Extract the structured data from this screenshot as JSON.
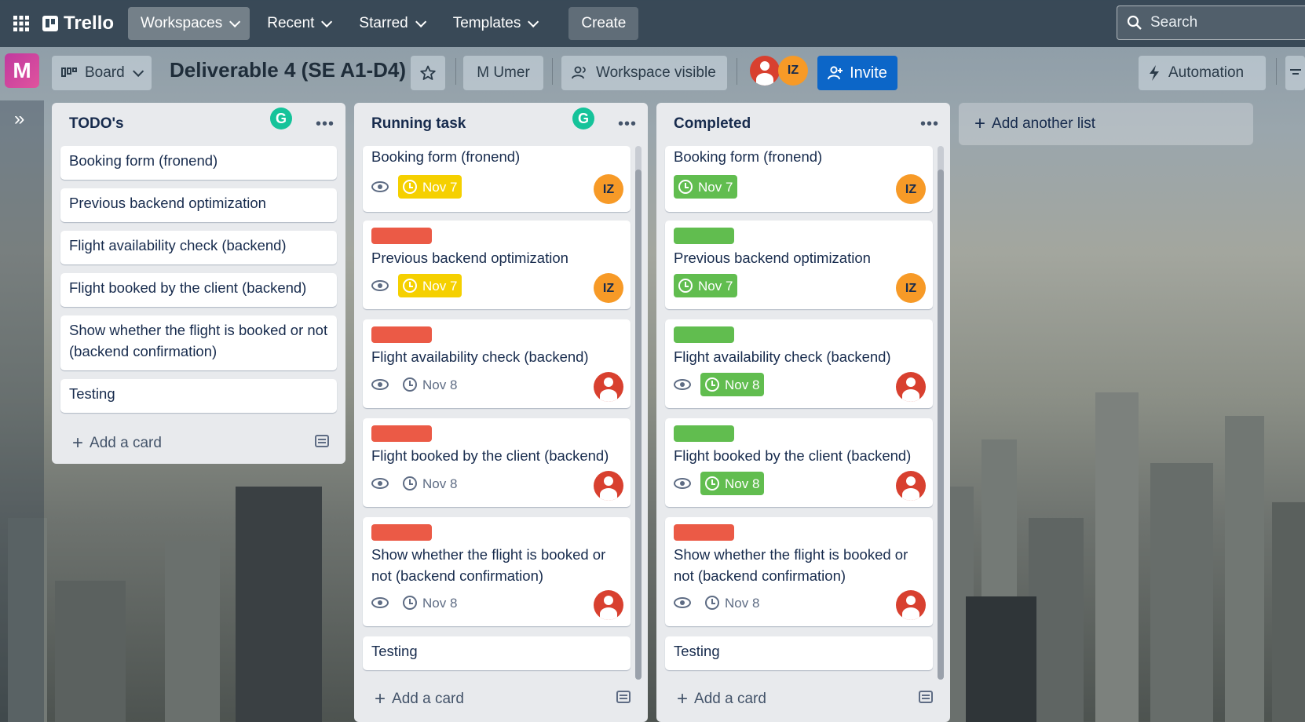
{
  "nav": {
    "logo": "Trello",
    "workspaces": "Workspaces",
    "recent": "Recent",
    "starred": "Starred",
    "templates": "Templates",
    "create": "Create",
    "search_placeholder": "Search"
  },
  "board": {
    "workspace_initial": "M",
    "view": "Board",
    "title": "Deliverable 4 (SE A1-D4)",
    "workspace_name": "M Umer",
    "visibility": "Workspace visible",
    "member_initials": "IZ",
    "invite": "Invite",
    "automation": "Automation"
  },
  "lists": [
    {
      "title": "TODO's",
      "cards": [
        "Booking form (fronend)",
        "Previous backend optimization",
        "Flight availability check (backend)",
        "Flight booked by the client (backend)",
        "Show whether the flight is booked or not (backend confirmation)",
        "Testing"
      ],
      "add_card": "Add a card"
    },
    {
      "title": "Running task",
      "cards": [
        {
          "text": "Booking form (fronend)",
          "due": "Nov 7",
          "due_style": "yellow",
          "member": "IZ"
        },
        {
          "text": "Previous backend optimization",
          "label": "red",
          "due": "Nov 7",
          "due_style": "yellow",
          "member": "IZ"
        },
        {
          "text": "Flight availability check (backend)",
          "label": "red",
          "due": "Nov 8",
          "due_style": "none",
          "member": "avatar"
        },
        {
          "text": "Flight booked by the client (backend)",
          "label": "red",
          "due": "Nov 8",
          "due_style": "none",
          "member": "avatar"
        },
        {
          "text": "Show whether the flight is booked or not (backend confirmation)",
          "label": "red",
          "due": "Nov 8",
          "due_style": "none",
          "member": "avatar"
        },
        {
          "text": "Testing"
        }
      ],
      "add_card": "Add a card"
    },
    {
      "title": "Completed",
      "cards": [
        {
          "text": "Booking form (fronend)",
          "due": "Nov 7",
          "due_style": "green",
          "member": "IZ"
        },
        {
          "text": "Previous backend optimization",
          "label": "green",
          "due": "Nov 7",
          "due_style": "green",
          "member": "IZ"
        },
        {
          "text": "Flight availability check (backend)",
          "label": "green",
          "due": "Nov 8",
          "due_style": "green",
          "member": "avatar"
        },
        {
          "text": "Flight booked by the client (backend)",
          "label": "green",
          "due": "Nov 8",
          "due_style": "green",
          "member": "avatar"
        },
        {
          "text": "Show whether the flight is booked or not (backend confirmation)",
          "label": "red",
          "due": "Nov 8",
          "due_style": "none",
          "member": "avatar"
        },
        {
          "text": "Testing"
        }
      ],
      "add_card": "Add a card"
    }
  ],
  "add_list": "Add another list",
  "colors": {
    "label_red": "#eb5a46",
    "label_green": "#61bd4f",
    "due_yellow": "#f5d000",
    "invite_blue": "#0c66c8",
    "avatar_orange": "#f79a27",
    "avatar_red": "#d8402f",
    "grammarly_green": "#15c39a"
  }
}
